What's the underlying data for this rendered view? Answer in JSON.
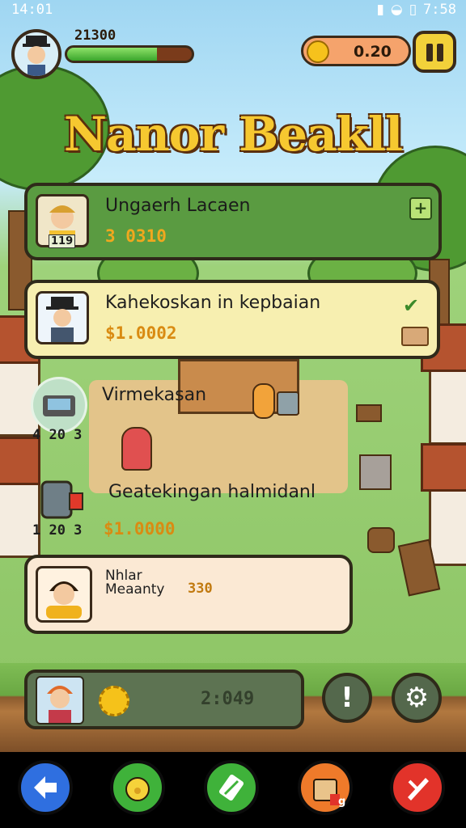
{
  "status_bar": {
    "time": "14:01",
    "clock": "7:58"
  },
  "player": {
    "xp_value": "21300",
    "xp_progress": 0.72
  },
  "currency": {
    "amount": "0.20"
  },
  "game_title": "Nanor Beakll",
  "cards": [
    {
      "name": "Ungaerh Lacaen",
      "price": "3 0310",
      "badge": "119"
    },
    {
      "name": "Kahekoskan in kepbaian",
      "price": "$1.0002"
    }
  ],
  "floating_items": [
    {
      "label": "Virmekasan",
      "count": "4 20 3"
    },
    {
      "label": "Geatekingan halmidanl",
      "count": "1 20 3",
      "price": "$1.0000"
    }
  ],
  "bottom_card": {
    "name": "Nhlar\nMeaanty",
    "value": "330"
  },
  "bottom_panel": {
    "timer": "2:049"
  },
  "buttons": {
    "alert_label": "!",
    "bag_badge": "g"
  },
  "colors": {
    "accent_gold": "#f6c830",
    "panel_green": "#5a9b41",
    "nav_blue": "#2f6fe0",
    "nav_green": "#3fb23a",
    "nav_orange": "#ef7a2a",
    "nav_red": "#e2332a"
  }
}
